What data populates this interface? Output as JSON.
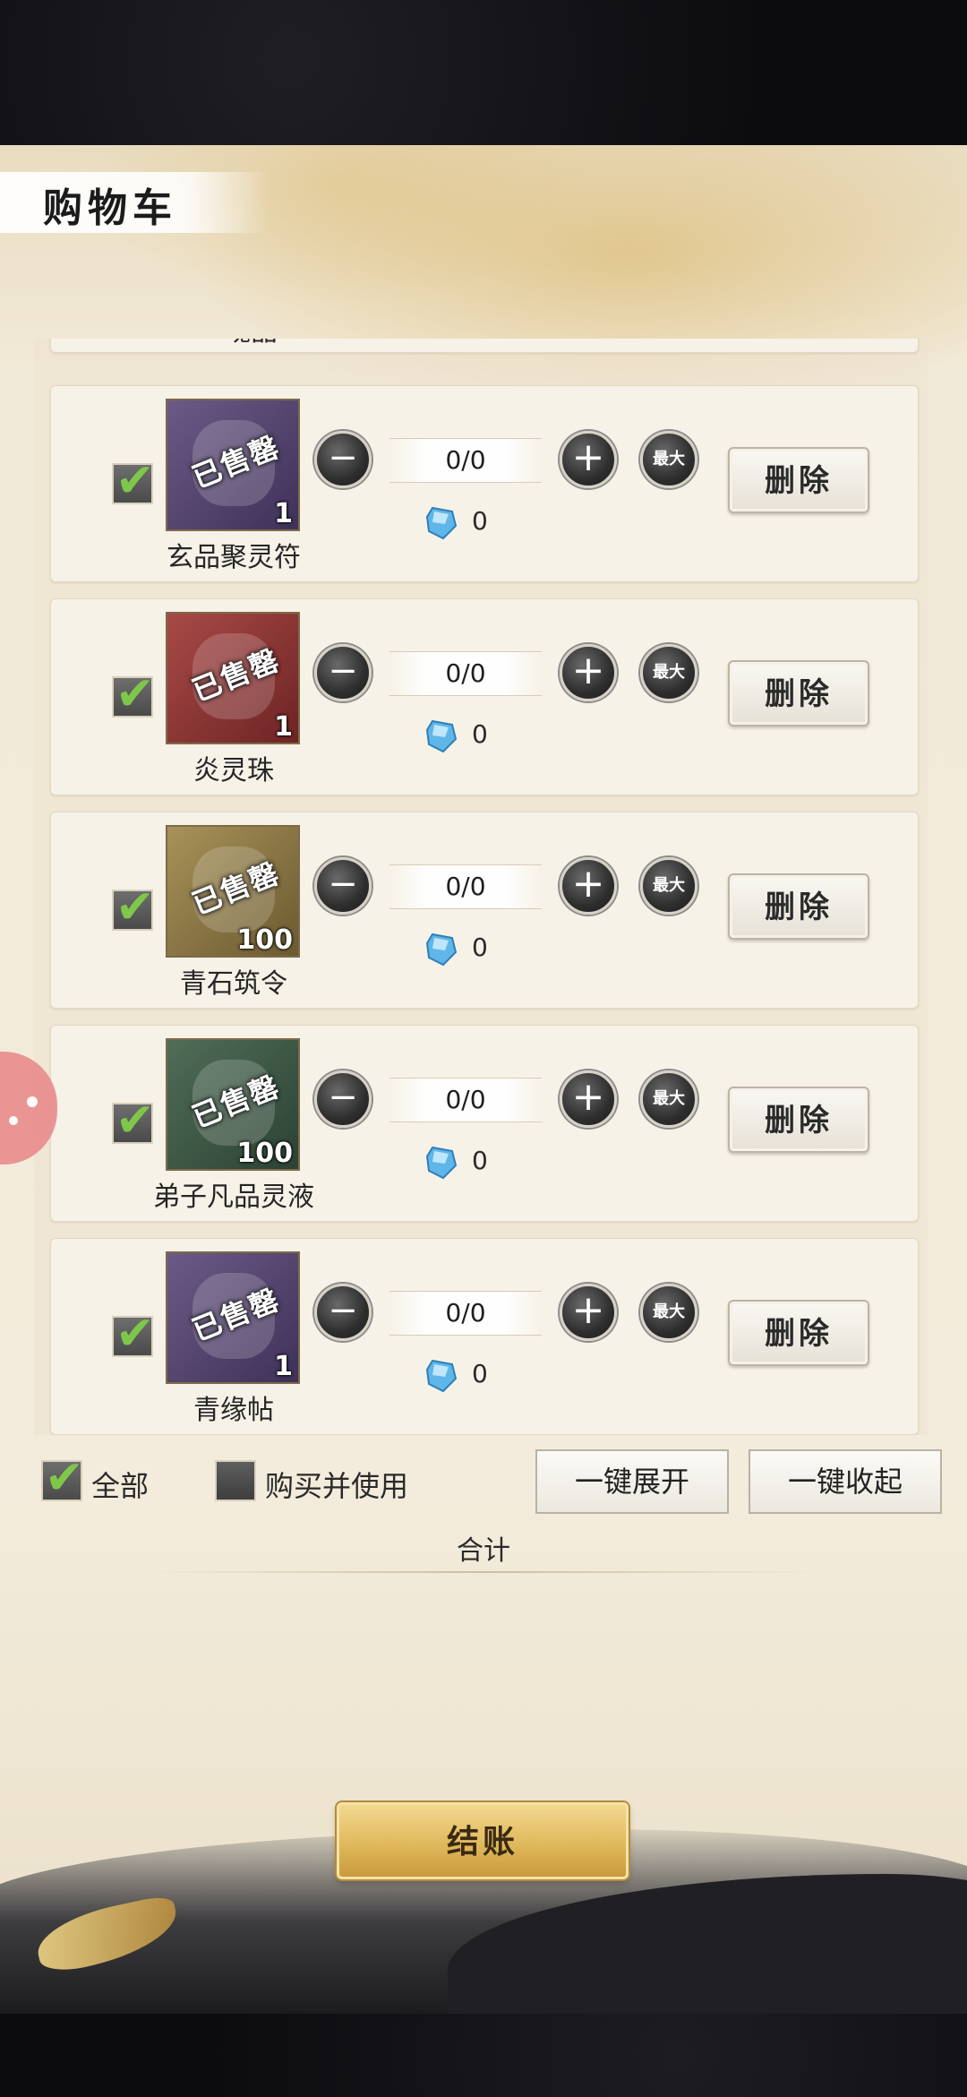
{
  "header": {
    "title": "购物车"
  },
  "partial_item": {
    "name": "魂晶"
  },
  "items": [
    {
      "name": "玄品聚灵符",
      "stamp": "已售罄",
      "count": "1",
      "quantity": "0/0",
      "price": "0",
      "max_label": "最大",
      "delete_label": "删除",
      "checked": true,
      "color_top": "#6c5a86",
      "color_bottom": "#3e3158"
    },
    {
      "name": "炎灵珠",
      "stamp": "已售罄",
      "count": "1",
      "quantity": "0/0",
      "price": "0",
      "max_label": "最大",
      "delete_label": "删除",
      "checked": true,
      "color_top": "#a84a47",
      "color_bottom": "#6d2424"
    },
    {
      "name": "青石筑令",
      "stamp": "已售罄",
      "count": "100",
      "quantity": "0/0",
      "price": "0",
      "max_label": "最大",
      "delete_label": "删除",
      "checked": true,
      "color_top": "#a8925a",
      "color_bottom": "#6b5a30"
    },
    {
      "name": "弟子凡品灵液",
      "stamp": "已售罄",
      "count": "100",
      "quantity": "0/0",
      "price": "0",
      "max_label": "最大",
      "delete_label": "删除",
      "checked": true,
      "color_top": "#4f6d57",
      "color_bottom": "#2c4234"
    },
    {
      "name": "青缘帖",
      "stamp": "已售罄",
      "count": "1",
      "quantity": "0/0",
      "price": "0",
      "max_label": "最大",
      "delete_label": "删除",
      "checked": true,
      "color_top": "#6c5a86",
      "color_bottom": "#3e3158"
    }
  ],
  "footer": {
    "select_all_label": "全部",
    "select_all_checked": true,
    "buy_and_use_label": "购买并使用",
    "buy_and_use_checked": false,
    "expand_all_label": "一键展开",
    "collapse_all_label": "一键收起",
    "total_label": "合计",
    "checkout_label": "结账"
  },
  "colors": {
    "check_green": "#7fc74a",
    "gold": "#e0b95c",
    "gem_blue": "#5fb6e8"
  }
}
